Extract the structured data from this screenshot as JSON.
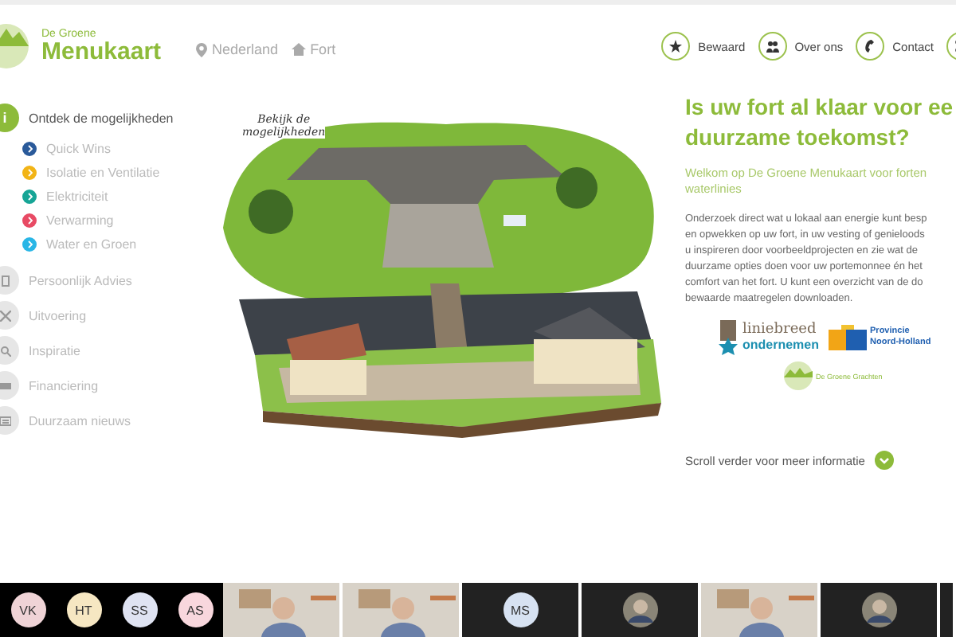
{
  "brand": {
    "small": "De Groene",
    "large": "Menukaart"
  },
  "breadcrumb": [
    {
      "label": "Nederland",
      "kind": "location"
    },
    {
      "label": "Fort",
      "kind": "home"
    }
  ],
  "nav": [
    {
      "label": "Bewaard",
      "kind": "star"
    },
    {
      "label": "Over ons",
      "kind": "people"
    },
    {
      "label": "Contact",
      "kind": "phone"
    },
    {
      "kind": "share"
    }
  ],
  "sidebar": {
    "items": [
      {
        "label": "Ontdek de mogelijkheden",
        "icon_text": "i",
        "selected": true,
        "expanded": true,
        "children": [
          {
            "label": "Quick Wins",
            "color": "#2a5a9a"
          },
          {
            "label": "Isolatie en Ventilatie",
            "color": "#f2b416"
          },
          {
            "label": "Elektriciteit",
            "color": "#16a596"
          },
          {
            "label": "Verwarming",
            "color": "#e84a64"
          },
          {
            "label": "Water en Groen",
            "color": "#29b6e6"
          }
        ]
      },
      {
        "label": "Persoonlijk Advies",
        "kind": "document",
        "selected": false
      },
      {
        "label": "Uitvoering",
        "kind": "tools",
        "selected": false
      },
      {
        "label": "Inspiratie",
        "kind": "search",
        "selected": false
      },
      {
        "label": "Financiering",
        "kind": "money",
        "selected": false
      },
      {
        "label": "Duurzaam nieuws",
        "kind": "news",
        "selected": false
      }
    ]
  },
  "hero": {
    "caption_lines": [
      "Bekijk de",
      "mogelijkheden"
    ]
  },
  "intro": {
    "heading_lines": [
      "Is uw fort al klaar voor ee",
      "duurzame toekomst?"
    ],
    "welcome_lines": [
      "Welkom op De Groene Menukaart voor forten",
      "waterlinies"
    ],
    "body_lines": [
      "Onderzoek direct wat u lokaal aan energie kunt besp",
      "en opwekken op uw fort, in uw vesting of genieloods",
      "u inspireren door voorbeeldprojecten en zie wat de",
      "duurzame opties doen voor uw portemonnee én het",
      "comfort van het fort. U kunt een overzicht van de do",
      "bewaarde maatregelen downloaden."
    ],
    "logos": [
      {
        "kind": "liniebreed",
        "lines": [
          "liniebreed",
          "ondernemen"
        ]
      },
      {
        "kind": "provincie",
        "lines": [
          "Provincie",
          "Noord-Holland"
        ]
      },
      {
        "kind": "grachten",
        "lines": [
          "De Groene Grachten"
        ]
      }
    ],
    "scroll_hint": "Scroll verder voor meer informatie"
  },
  "participants": [
    {
      "kind": "initials",
      "initials": "VK",
      "color": "#efd3d6"
    },
    {
      "kind": "initials",
      "initials": "HT",
      "color": "#f6e7c2"
    },
    {
      "kind": "initials",
      "initials": "SS",
      "color": "#dfe3f2"
    },
    {
      "kind": "initials",
      "initials": "AS",
      "color": "#f8d7dd"
    },
    {
      "kind": "video"
    },
    {
      "kind": "video"
    },
    {
      "kind": "tile",
      "initials": "MS",
      "color": "#d7e2f2"
    },
    {
      "kind": "avatar"
    },
    {
      "kind": "video"
    },
    {
      "kind": "avatar"
    }
  ]
}
